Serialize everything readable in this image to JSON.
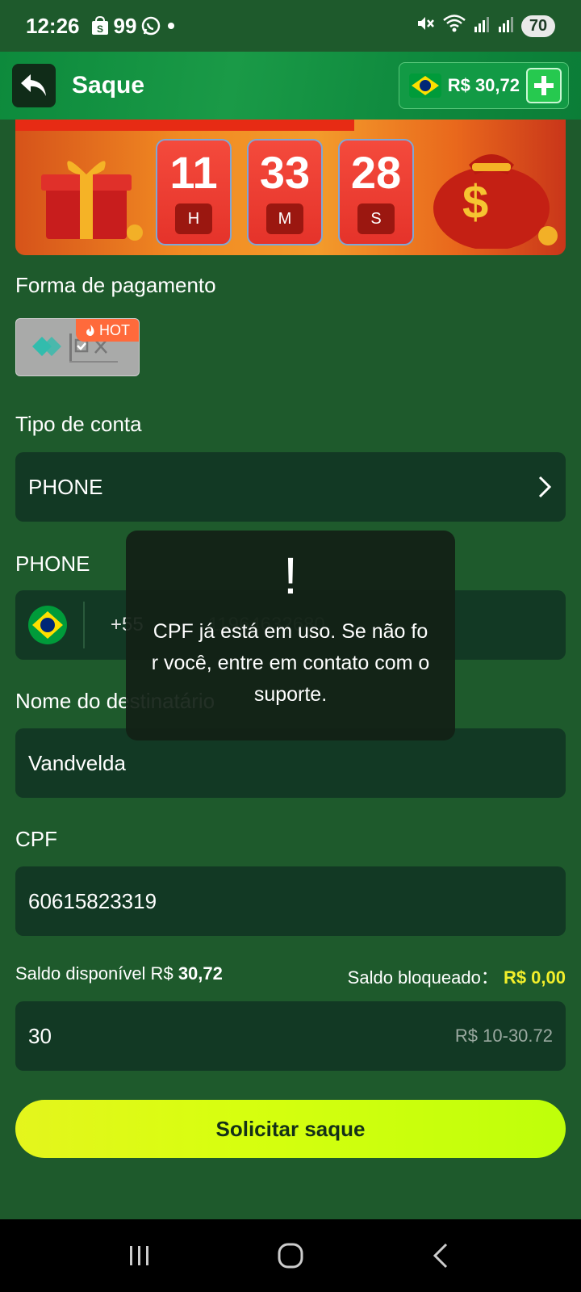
{
  "status_bar": {
    "time": "12:26",
    "notif_count": "99",
    "battery": "70"
  },
  "header": {
    "title": "Saque",
    "balance": "R$ 30,72"
  },
  "timer": {
    "hours": "11",
    "minutes": "33",
    "seconds": "28",
    "hours_unit": "H",
    "minutes_unit": "M",
    "seconds_unit": "S"
  },
  "payment": {
    "label": "Forma de pagamento",
    "method_badge": "HOT"
  },
  "account_type": {
    "label": "Tipo de conta",
    "value": "PHONE"
  },
  "phone": {
    "label": "PHONE",
    "country_code": "+55",
    "number": "11964632680"
  },
  "recipient": {
    "label": "Nome do destinatário",
    "value": "Vandvelda"
  },
  "cpf": {
    "label": "CPF",
    "value": "60615823319"
  },
  "saldo": {
    "available_label": "Saldo disponível R$",
    "available_value": "30,72",
    "blocked_label": "Saldo bloqueado：",
    "blocked_value": "R$ 0,00"
  },
  "amount": {
    "value": "30",
    "range_hint": "R$ 10-30.72"
  },
  "submit_label": "Solicitar saque",
  "toast": {
    "icon": "!",
    "message": "CPF já está em uso. Se não for você, entre em contato com o suporte."
  },
  "colors": {
    "background": "#1e5a2c",
    "field": "#123924",
    "accent_yellow": "#f2ef2b",
    "button": "#d7ff0f"
  }
}
